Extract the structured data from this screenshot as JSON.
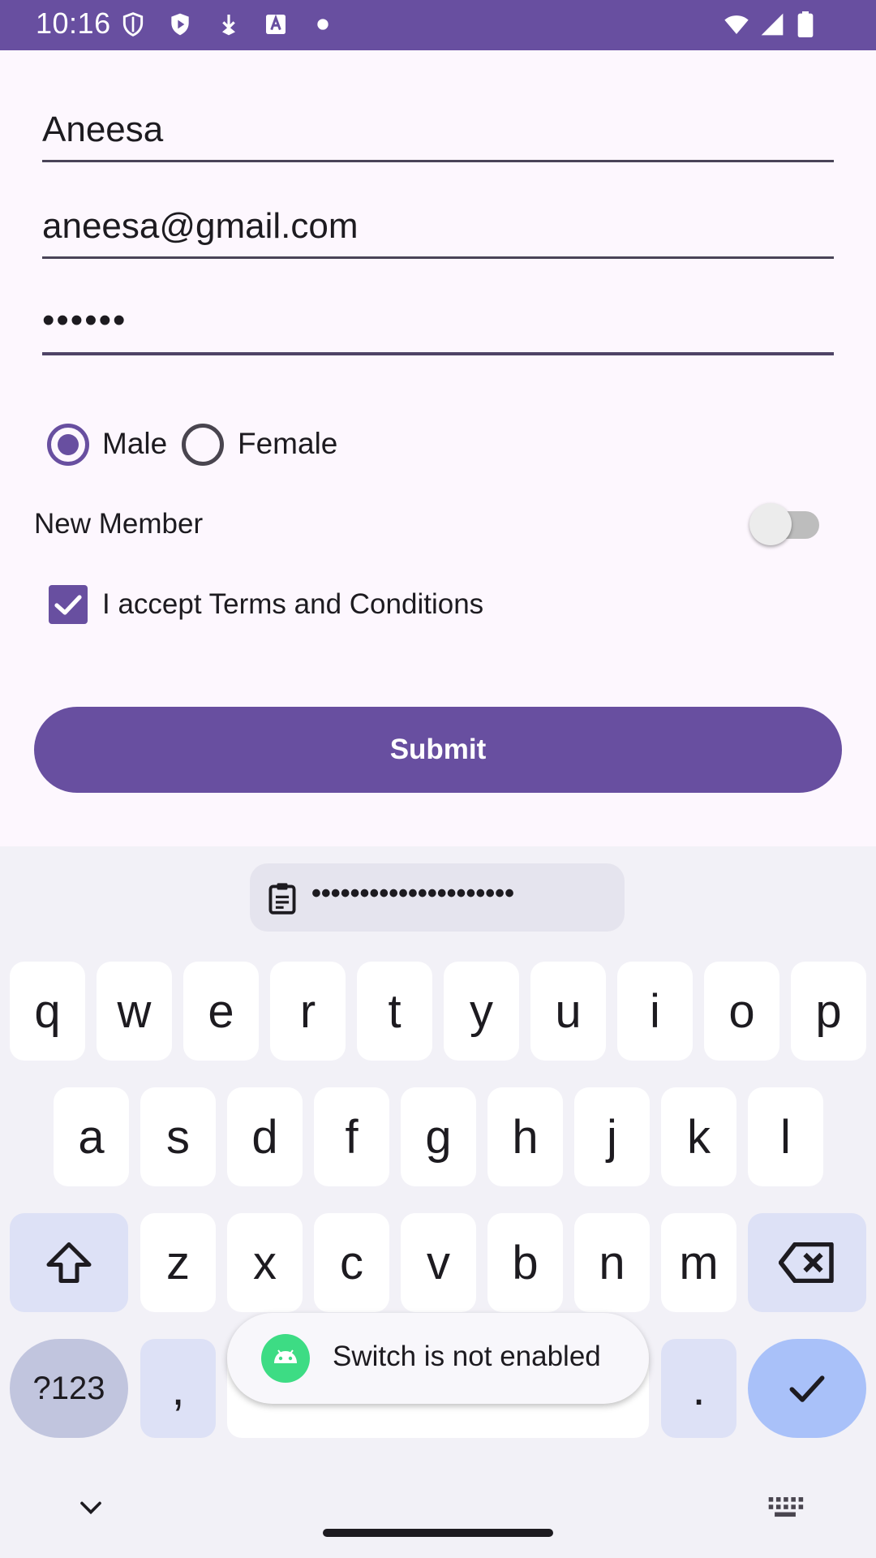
{
  "status_bar": {
    "time": "10:16",
    "icons": [
      "shield-icon",
      "play-shield-icon",
      "download-icon",
      "font-app-icon",
      "dot-icon",
      "wifi-icon",
      "signal-icon",
      "battery-icon"
    ]
  },
  "form": {
    "name_value": "Aneesa",
    "email_value": "aneesa@gmail.com",
    "password_value": "••••••",
    "gender_options": [
      "Male",
      "Female"
    ],
    "gender_selected": "Male",
    "switch_label": "New Member",
    "switch_on": false,
    "terms_label": "I accept Terms and Conditions",
    "terms_checked": true,
    "submit_label": "Submit"
  },
  "keyboard": {
    "clipboard_text": "•••••••••••••••••••••",
    "row1": [
      "q",
      "w",
      "e",
      "r",
      "t",
      "y",
      "u",
      "i",
      "o",
      "p"
    ],
    "row2": [
      "a",
      "s",
      "d",
      "f",
      "g",
      "h",
      "j",
      "k",
      "l"
    ],
    "row3": [
      "z",
      "x",
      "c",
      "v",
      "b",
      "n",
      "m"
    ],
    "symbols_label": "?123",
    "comma_label": ",",
    "period_label": "."
  },
  "toast": {
    "message": "Switch is not enabled"
  },
  "colors": {
    "primary": "#684fa0",
    "background": "#fdf7fe",
    "keyboard_bg": "#f2f1f7",
    "enter_key": "#a9c1f9",
    "modifier_key": "#dde1f6"
  }
}
